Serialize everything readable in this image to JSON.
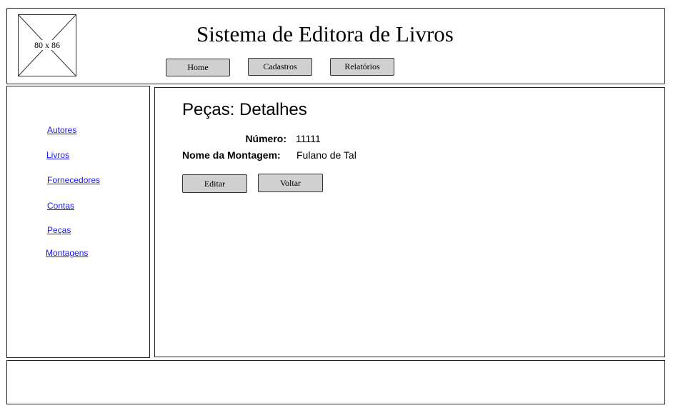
{
  "header": {
    "logo_placeholder": "80 x 86",
    "title": "Sistema de Editora de Livros",
    "nav": {
      "home": "Home",
      "cadastros": "Cadastros",
      "relatorios": "Relatórios"
    }
  },
  "sidebar": {
    "items": [
      {
        "label": "Autores"
      },
      {
        "label": "Livros"
      },
      {
        "label": "Fornecedores"
      },
      {
        "label": "Contas"
      },
      {
        "label": "Peças"
      },
      {
        "label": "Montagens"
      }
    ],
    "link_color": "#1a1aee"
  },
  "main": {
    "heading": "Peças: Detalhes",
    "fields": {
      "numero_label": "Número:",
      "numero_value": "11111",
      "nome_label": "Nome da Montagem:",
      "nome_value": "Fulano de Tal"
    },
    "buttons": {
      "editar": "Editar",
      "voltar": "Voltar"
    }
  },
  "colors": {
    "button_bg": "#d0d0d0",
    "border": "#222222"
  }
}
